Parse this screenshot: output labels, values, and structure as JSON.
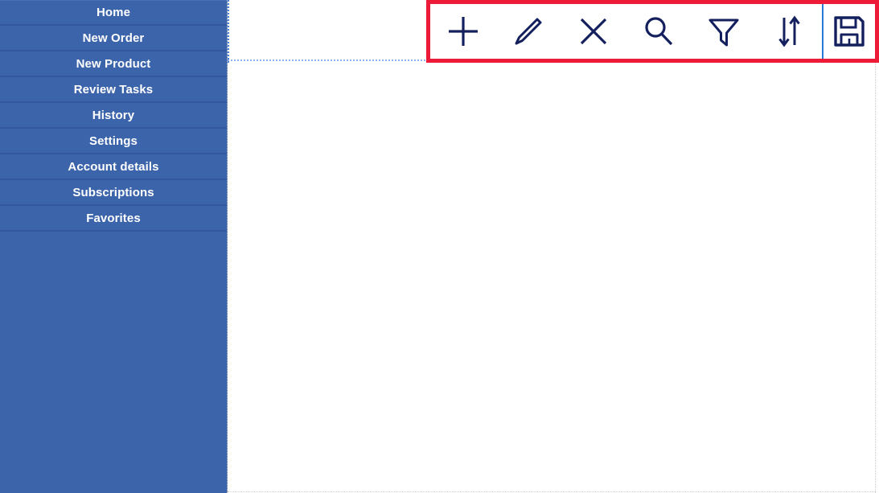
{
  "theme": {
    "sidebar_bg": "#3c64ab",
    "sidebar_text": "#ffffff",
    "separator": "#3358a0",
    "toolbar_border": "#ed1b38",
    "icon_color": "#14205e",
    "divider": "#2a7ad4",
    "content_bg": "#ffffff",
    "dotted_rule": "#8fb4e8"
  },
  "sidebar": {
    "items": [
      {
        "label": "Home",
        "name": "home"
      },
      {
        "label": "New Order",
        "name": "new-order"
      },
      {
        "label": "New Product",
        "name": "new-product"
      },
      {
        "label": "Review Tasks",
        "name": "review-tasks"
      },
      {
        "label": "History",
        "name": "history"
      },
      {
        "label": "Settings",
        "name": "settings"
      },
      {
        "label": "Account details",
        "name": "account-details"
      },
      {
        "label": "Subscriptions",
        "name": "subscriptions"
      },
      {
        "label": "Favorites",
        "name": "favorites"
      }
    ]
  },
  "toolbar": {
    "highlighted": true,
    "buttons": [
      {
        "icon": "plus-icon",
        "label": "Add"
      },
      {
        "icon": "pencil-icon",
        "label": "Edit"
      },
      {
        "icon": "close-icon",
        "label": "Delete"
      },
      {
        "icon": "search-icon",
        "label": "Search"
      },
      {
        "icon": "filter-icon",
        "label": "Filter"
      },
      {
        "icon": "sort-icon",
        "label": "Sort"
      },
      {
        "icon": "save-icon",
        "label": "Save"
      }
    ]
  },
  "main": {
    "content": ""
  }
}
